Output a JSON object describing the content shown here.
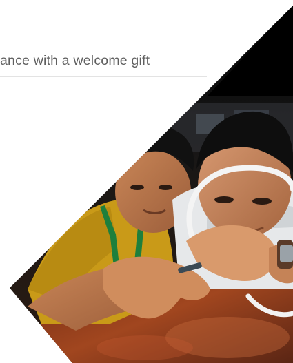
{
  "promo": {
    "text": "ance with a welcome gift"
  },
  "icons": {
    "photo": "product-testing-photo"
  }
}
